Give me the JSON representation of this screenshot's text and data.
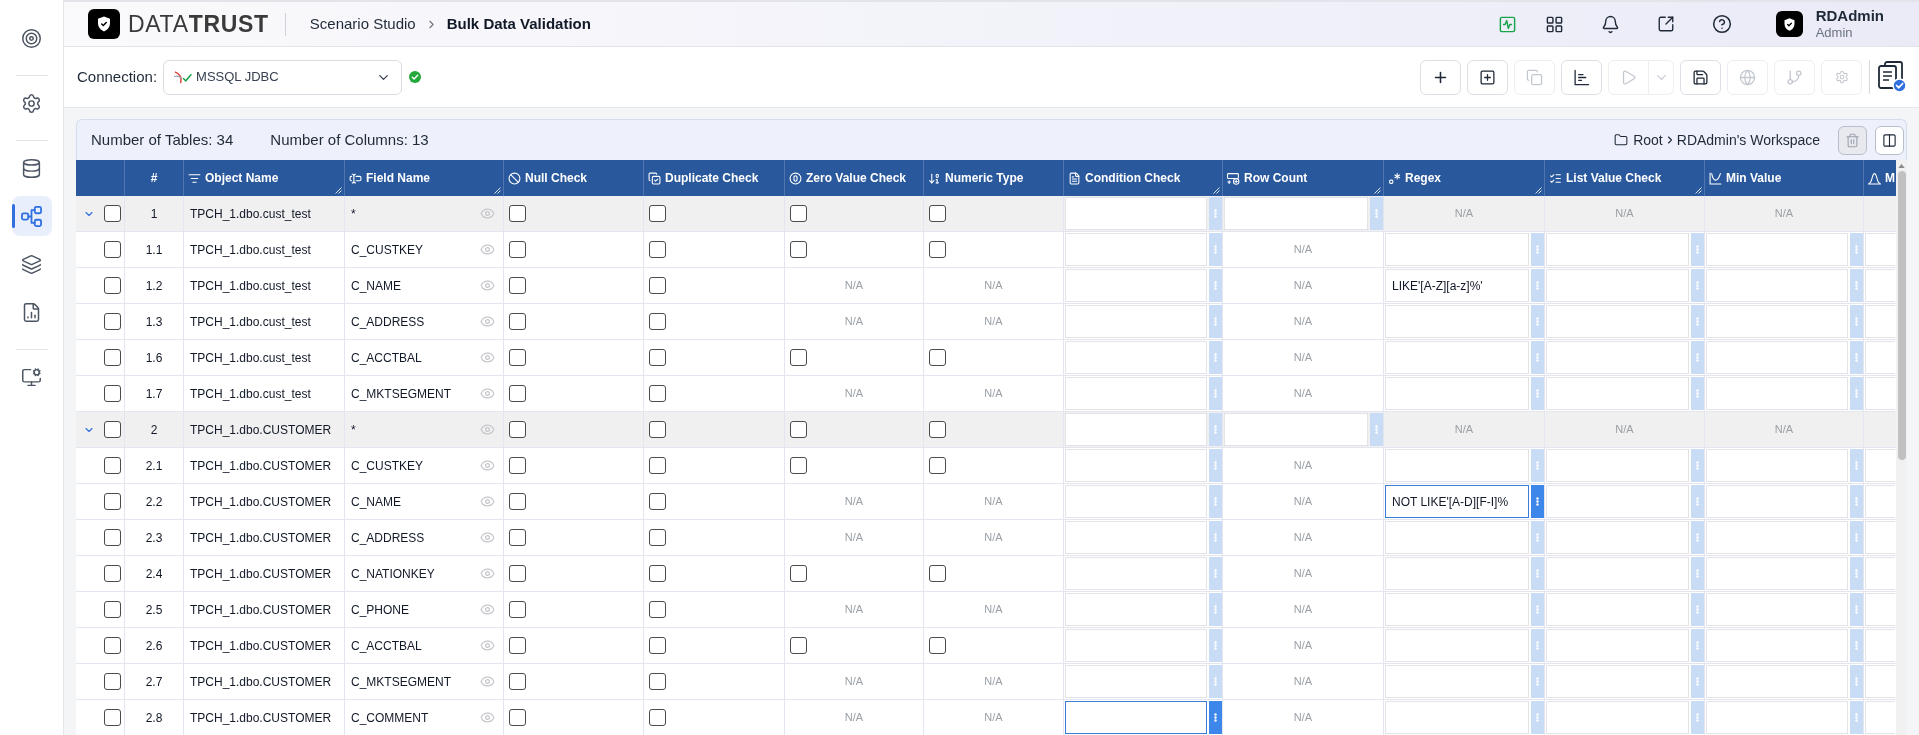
{
  "sidebar": {
    "groups": [
      {
        "items": [
          {
            "selected": false
          }
        ]
      },
      {
        "items": [
          {
            "selected": false
          }
        ]
      },
      {
        "items": [
          {
            "selected": false
          },
          {
            "selected": true
          },
          {
            "selected": false
          },
          {
            "selected": false
          }
        ]
      },
      {
        "items": [
          {
            "selected": false
          }
        ]
      }
    ]
  },
  "header": {
    "logo": "DATA**TRUST**",
    "breadcrumb": [
      {
        "label": "Scenario Studio",
        "current": false
      },
      {
        "label": "Bulk Data Validation",
        "current": true
      }
    ],
    "user": {
      "name": "RDAdmin",
      "role": "Admin"
    }
  },
  "connection": {
    "label": "Connection:",
    "value": "MSSQL JDBC",
    "connected": true
  },
  "toolbar": {
    "buttons": [
      {
        "kind": "plain",
        "disabled": false
      },
      {
        "kind": "plain",
        "disabled": false
      },
      {
        "kind": "plain",
        "disabled": true
      },
      {
        "kind": "plain",
        "disabled": false
      },
      {
        "kind": "split",
        "disabled": true
      },
      {
        "kind": "plain",
        "disabled": false
      },
      {
        "kind": "plain",
        "disabled": true
      },
      {
        "kind": "plain",
        "disabled": true
      },
      {
        "kind": "plain",
        "disabled": true
      }
    ]
  },
  "info_bar": {
    "tables": "Number of Tables: 34",
    "columns": "Number of Columns: 13",
    "path": [
      "Root",
      "RDAdmin's Workspace"
    ],
    "actions": [
      {
        "disabled": true
      },
      {
        "disabled": false
      }
    ]
  },
  "table": {
    "columns": [
      {
        "label": "#",
        "resizable": false
      },
      {
        "label": "Object Name",
        "resizable": true
      },
      {
        "label": "Field Name",
        "resizable": true
      },
      {
        "label": "Null Check",
        "resizable": false
      },
      {
        "label": "Duplicate Check",
        "resizable": false
      },
      {
        "label": "Zero Value Check",
        "resizable": false
      },
      {
        "label": "Numeric Type",
        "resizable": false
      },
      {
        "label": "Condition Check",
        "resizable": true
      },
      {
        "label": "Row Count",
        "resizable": true
      },
      {
        "label": "Regex",
        "resizable": true
      },
      {
        "label": "List Value Check",
        "resizable": true
      },
      {
        "label": "Min Value",
        "resizable": false
      },
      {
        "label": "M",
        "resizable": false
      }
    ],
    "rows": [
      {
        "kind": "group",
        "expanded": true,
        "selected": false,
        "cells": [
          {
            "kind": "text",
            "text": "1"
          },
          {
            "kind": "text",
            "text": "TPCH_1.dbo.cust_test"
          },
          {
            "kind": "field",
            "text": "*"
          },
          {
            "kind": "checkbox",
            "checked": false
          },
          {
            "kind": "checkbox",
            "checked": false
          },
          {
            "kind": "checkbox",
            "checked": false
          },
          {
            "kind": "checkbox",
            "checked": false
          },
          {
            "kind": "input",
            "focused": false
          },
          {
            "kind": "input",
            "focused": false
          },
          {
            "kind": "na",
            "text": "N/A"
          },
          {
            "kind": "na",
            "text": "N/A"
          },
          {
            "kind": "na",
            "text": "N/A"
          }
        ]
      },
      {
        "kind": "field",
        "selected": false,
        "cells": [
          {
            "kind": "text",
            "text": "1.1"
          },
          {
            "kind": "text",
            "text": "TPCH_1.dbo.cust_test"
          },
          {
            "kind": "field",
            "text": "C_CUSTKEY"
          },
          {
            "kind": "checkbox",
            "checked": false
          },
          {
            "kind": "checkbox",
            "checked": false
          },
          {
            "kind": "checkbox",
            "checked": false
          },
          {
            "kind": "checkbox",
            "checked": false
          },
          {
            "kind": "input",
            "focused": false
          },
          {
            "kind": "na",
            "text": "N/A"
          },
          {
            "kind": "input",
            "focused": false
          },
          {
            "kind": "input",
            "focused": false
          },
          {
            "kind": "input",
            "focused": false
          },
          {
            "kind": "input",
            "focused": false
          }
        ]
      },
      {
        "kind": "field",
        "selected": false,
        "cells": [
          {
            "kind": "text",
            "text": "1.2"
          },
          {
            "kind": "text",
            "text": "TPCH_1.dbo.cust_test"
          },
          {
            "kind": "field",
            "text": "C_NAME"
          },
          {
            "kind": "checkbox",
            "checked": false
          },
          {
            "kind": "checkbox",
            "checked": false
          },
          {
            "kind": "na",
            "text": "N/A"
          },
          {
            "kind": "na",
            "text": "N/A"
          },
          {
            "kind": "input",
            "focused": false
          },
          {
            "kind": "na",
            "text": "N/A"
          },
          {
            "kind": "input",
            "value": "LIKE'[A-Z][a-z]%'",
            "focused": false
          },
          {
            "kind": "input",
            "focused": false
          },
          {
            "kind": "input",
            "focused": false
          },
          {
            "kind": "input",
            "focused": false
          }
        ]
      },
      {
        "kind": "field",
        "selected": false,
        "cells": [
          {
            "kind": "text",
            "text": "1.3"
          },
          {
            "kind": "text",
            "text": "TPCH_1.dbo.cust_test"
          },
          {
            "kind": "field",
            "text": "C_ADDRESS"
          },
          {
            "kind": "checkbox",
            "checked": false
          },
          {
            "kind": "checkbox",
            "checked": false
          },
          {
            "kind": "na",
            "text": "N/A"
          },
          {
            "kind": "na",
            "text": "N/A"
          },
          {
            "kind": "input",
            "focused": false
          },
          {
            "kind": "na",
            "text": "N/A"
          },
          {
            "kind": "input",
            "focused": false
          },
          {
            "kind": "input",
            "focused": false
          },
          {
            "kind": "input",
            "focused": false
          },
          {
            "kind": "input",
            "focused": false
          }
        ]
      },
      {
        "kind": "field",
        "selected": false,
        "cells": [
          {
            "kind": "text",
            "text": "1.6"
          },
          {
            "kind": "text",
            "text": "TPCH_1.dbo.cust_test"
          },
          {
            "kind": "field",
            "text": "C_ACCTBAL"
          },
          {
            "kind": "checkbox",
            "checked": false
          },
          {
            "kind": "checkbox",
            "checked": false
          },
          {
            "kind": "checkbox",
            "checked": false
          },
          {
            "kind": "checkbox",
            "checked": false
          },
          {
            "kind": "input",
            "focused": false
          },
          {
            "kind": "na",
            "text": "N/A"
          },
          {
            "kind": "input",
            "focused": false
          },
          {
            "kind": "input",
            "focused": false
          },
          {
            "kind": "input",
            "focused": false
          },
          {
            "kind": "input",
            "focused": false
          }
        ]
      },
      {
        "kind": "field",
        "selected": false,
        "cells": [
          {
            "kind": "text",
            "text": "1.7"
          },
          {
            "kind": "text",
            "text": "TPCH_1.dbo.cust_test"
          },
          {
            "kind": "field",
            "text": "C_MKTSEGMENT"
          },
          {
            "kind": "checkbox",
            "checked": false
          },
          {
            "kind": "checkbox",
            "checked": false
          },
          {
            "kind": "na",
            "text": "N/A"
          },
          {
            "kind": "na",
            "text": "N/A"
          },
          {
            "kind": "input",
            "focused": false
          },
          {
            "kind": "na",
            "text": "N/A"
          },
          {
            "kind": "input",
            "focused": false
          },
          {
            "kind": "input",
            "focused": false
          },
          {
            "kind": "input",
            "focused": false
          },
          {
            "kind": "input",
            "focused": false
          }
        ]
      },
      {
        "kind": "group",
        "expanded": true,
        "selected": false,
        "cells": [
          {
            "kind": "text",
            "text": "2"
          },
          {
            "kind": "text",
            "text": "TPCH_1.dbo.CUSTOMER"
          },
          {
            "kind": "field",
            "text": "*"
          },
          {
            "kind": "checkbox",
            "checked": false
          },
          {
            "kind": "checkbox",
            "checked": false
          },
          {
            "kind": "checkbox",
            "checked": false
          },
          {
            "kind": "checkbox",
            "checked": false
          },
          {
            "kind": "input",
            "focused": false
          },
          {
            "kind": "input",
            "focused": false
          },
          {
            "kind": "na",
            "text": "N/A"
          },
          {
            "kind": "na",
            "text": "N/A"
          },
          {
            "kind": "na",
            "text": "N/A"
          }
        ]
      },
      {
        "kind": "field",
        "selected": false,
        "cells": [
          {
            "kind": "text",
            "text": "2.1"
          },
          {
            "kind": "text",
            "text": "TPCH_1.dbo.CUSTOMER"
          },
          {
            "kind": "field",
            "text": "C_CUSTKEY"
          },
          {
            "kind": "checkbox",
            "checked": false
          },
          {
            "kind": "checkbox",
            "checked": false
          },
          {
            "kind": "checkbox",
            "checked": false
          },
          {
            "kind": "checkbox",
            "checked": false
          },
          {
            "kind": "input",
            "focused": false
          },
          {
            "kind": "na",
            "text": "N/A"
          },
          {
            "kind": "input",
            "focused": false
          },
          {
            "kind": "input",
            "focused": false
          },
          {
            "kind": "input",
            "focused": false
          },
          {
            "kind": "input",
            "focused": false
          }
        ]
      },
      {
        "kind": "field",
        "selected": false,
        "cells": [
          {
            "kind": "text",
            "text": "2.2"
          },
          {
            "kind": "text",
            "text": "TPCH_1.dbo.CUSTOMER"
          },
          {
            "kind": "field",
            "text": "C_NAME"
          },
          {
            "kind": "checkbox",
            "checked": false
          },
          {
            "kind": "checkbox",
            "checked": false
          },
          {
            "kind": "na",
            "text": "N/A"
          },
          {
            "kind": "na",
            "text": "N/A"
          },
          {
            "kind": "input",
            "focused": false
          },
          {
            "kind": "na",
            "text": "N/A"
          },
          {
            "kind": "input",
            "value": "NOT LIKE'[A-D][F-I]%",
            "focused": true
          },
          {
            "kind": "input",
            "focused": false
          },
          {
            "kind": "input",
            "focused": false
          },
          {
            "kind": "input",
            "focused": false
          }
        ]
      },
      {
        "kind": "field",
        "selected": false,
        "cells": [
          {
            "kind": "text",
            "text": "2.3"
          },
          {
            "kind": "text",
            "text": "TPCH_1.dbo.CUSTOMER"
          },
          {
            "kind": "field",
            "text": "C_ADDRESS"
          },
          {
            "kind": "checkbox",
            "checked": false
          },
          {
            "kind": "checkbox",
            "checked": false
          },
          {
            "kind": "na",
            "text": "N/A"
          },
          {
            "kind": "na",
            "text": "N/A"
          },
          {
            "kind": "input",
            "focused": false
          },
          {
            "kind": "na",
            "text": "N/A"
          },
          {
            "kind": "input",
            "focused": false
          },
          {
            "kind": "input",
            "focused": false
          },
          {
            "kind": "input",
            "focused": false
          },
          {
            "kind": "input",
            "focused": false
          }
        ]
      },
      {
        "kind": "field",
        "selected": false,
        "cells": [
          {
            "kind": "text",
            "text": "2.4"
          },
          {
            "kind": "text",
            "text": "TPCH_1.dbo.CUSTOMER"
          },
          {
            "kind": "field",
            "text": "C_NATIONKEY"
          },
          {
            "kind": "checkbox",
            "checked": false
          },
          {
            "kind": "checkbox",
            "checked": false
          },
          {
            "kind": "checkbox",
            "checked": false
          },
          {
            "kind": "checkbox",
            "checked": false
          },
          {
            "kind": "input",
            "focused": false
          },
          {
            "kind": "na",
            "text": "N/A"
          },
          {
            "kind": "input",
            "focused": false
          },
          {
            "kind": "input",
            "focused": false
          },
          {
            "kind": "input",
            "focused": false
          },
          {
            "kind": "input",
            "focused": false
          }
        ]
      },
      {
        "kind": "field",
        "selected": false,
        "cells": [
          {
            "kind": "text",
            "text": "2.5"
          },
          {
            "kind": "text",
            "text": "TPCH_1.dbo.CUSTOMER"
          },
          {
            "kind": "field",
            "text": "C_PHONE"
          },
          {
            "kind": "checkbox",
            "checked": false
          },
          {
            "kind": "checkbox",
            "checked": false
          },
          {
            "kind": "na",
            "text": "N/A"
          },
          {
            "kind": "na",
            "text": "N/A"
          },
          {
            "kind": "input",
            "focused": false
          },
          {
            "kind": "na",
            "text": "N/A"
          },
          {
            "kind": "input",
            "focused": false
          },
          {
            "kind": "input",
            "focused": false
          },
          {
            "kind": "input",
            "focused": false
          },
          {
            "kind": "input",
            "focused": false
          }
        ]
      },
      {
        "kind": "field",
        "selected": false,
        "cells": [
          {
            "kind": "text",
            "text": "2.6"
          },
          {
            "kind": "text",
            "text": "TPCH_1.dbo.CUSTOMER"
          },
          {
            "kind": "field",
            "text": "C_ACCTBAL"
          },
          {
            "kind": "checkbox",
            "checked": false
          },
          {
            "kind": "checkbox",
            "checked": false
          },
          {
            "kind": "checkbox",
            "checked": false
          },
          {
            "kind": "checkbox",
            "checked": false
          },
          {
            "kind": "input",
            "focused": false
          },
          {
            "kind": "na",
            "text": "N/A"
          },
          {
            "kind": "input",
            "focused": false
          },
          {
            "kind": "input",
            "focused": false
          },
          {
            "kind": "input",
            "focused": false
          },
          {
            "kind": "input",
            "focused": false
          }
        ]
      },
      {
        "kind": "field",
        "selected": false,
        "cells": [
          {
            "kind": "text",
            "text": "2.7"
          },
          {
            "kind": "text",
            "text": "TPCH_1.dbo.CUSTOMER"
          },
          {
            "kind": "field",
            "text": "C_MKTSEGMENT"
          },
          {
            "kind": "checkbox",
            "checked": false
          },
          {
            "kind": "checkbox",
            "checked": false
          },
          {
            "kind": "na",
            "text": "N/A"
          },
          {
            "kind": "na",
            "text": "N/A"
          },
          {
            "kind": "input",
            "focused": false
          },
          {
            "kind": "na",
            "text": "N/A"
          },
          {
            "kind": "input",
            "focused": false
          },
          {
            "kind": "input",
            "focused": false
          },
          {
            "kind": "input",
            "focused": false
          },
          {
            "kind": "input",
            "focused": false
          }
        ]
      },
      {
        "kind": "field",
        "selected": false,
        "cells": [
          {
            "kind": "text",
            "text": "2.8"
          },
          {
            "kind": "text",
            "text": "TPCH_1.dbo.CUSTOMER"
          },
          {
            "kind": "field",
            "text": "C_COMMENT"
          },
          {
            "kind": "checkbox",
            "checked": false
          },
          {
            "kind": "checkbox",
            "checked": false
          },
          {
            "kind": "na",
            "text": "N/A"
          },
          {
            "kind": "na",
            "text": "N/A"
          },
          {
            "kind": "input",
            "focused": true
          },
          {
            "kind": "na",
            "text": "N/A"
          },
          {
            "kind": "input",
            "focused": false
          },
          {
            "kind": "input",
            "focused": false
          },
          {
            "kind": "input",
            "focused": false
          },
          {
            "kind": "input",
            "focused": false
          }
        ]
      }
    ]
  }
}
